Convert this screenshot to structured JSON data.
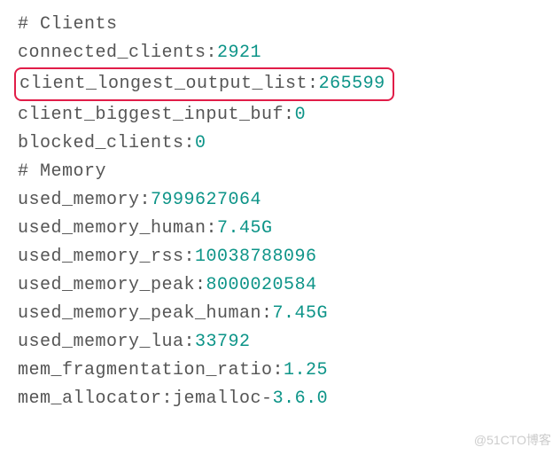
{
  "lines": [
    {
      "type": "comment",
      "text": "# Clients"
    },
    {
      "type": "kv",
      "key": "connected_clients",
      "value": "2921",
      "valueType": "num"
    },
    {
      "type": "kv",
      "key": "client_longest_output_list",
      "value": "265599",
      "valueType": "num",
      "highlighted": true
    },
    {
      "type": "kv",
      "key": "client_biggest_input_buf",
      "value": "0",
      "valueType": "num"
    },
    {
      "type": "kv",
      "key": "blocked_clients",
      "value": "0",
      "valueType": "num"
    },
    {
      "type": "comment",
      "text": "# Memory"
    },
    {
      "type": "kv",
      "key": "used_memory",
      "value": "7999627064",
      "valueType": "num"
    },
    {
      "type": "kv",
      "key": "used_memory_human",
      "value": "7.45G",
      "valueType": "num"
    },
    {
      "type": "kv",
      "key": "used_memory_rss",
      "value": "10038788096",
      "valueType": "num"
    },
    {
      "type": "kv",
      "key": "used_memory_peak",
      "value": "8000020584",
      "valueType": "num"
    },
    {
      "type": "kv",
      "key": "used_memory_peak_human",
      "value": "7.45G",
      "valueType": "num"
    },
    {
      "type": "kv",
      "key": "used_memory_lua",
      "value": "33792",
      "valueType": "num"
    },
    {
      "type": "kv",
      "key": "mem_fragmentation_ratio",
      "value": "1.25",
      "valueType": "num"
    },
    {
      "type": "kv-compound",
      "key": "mem_allocator",
      "valueText": "jemalloc",
      "dash": "-",
      "valueNum": "3.6.0"
    }
  ],
  "watermark": "@51CTO博客"
}
